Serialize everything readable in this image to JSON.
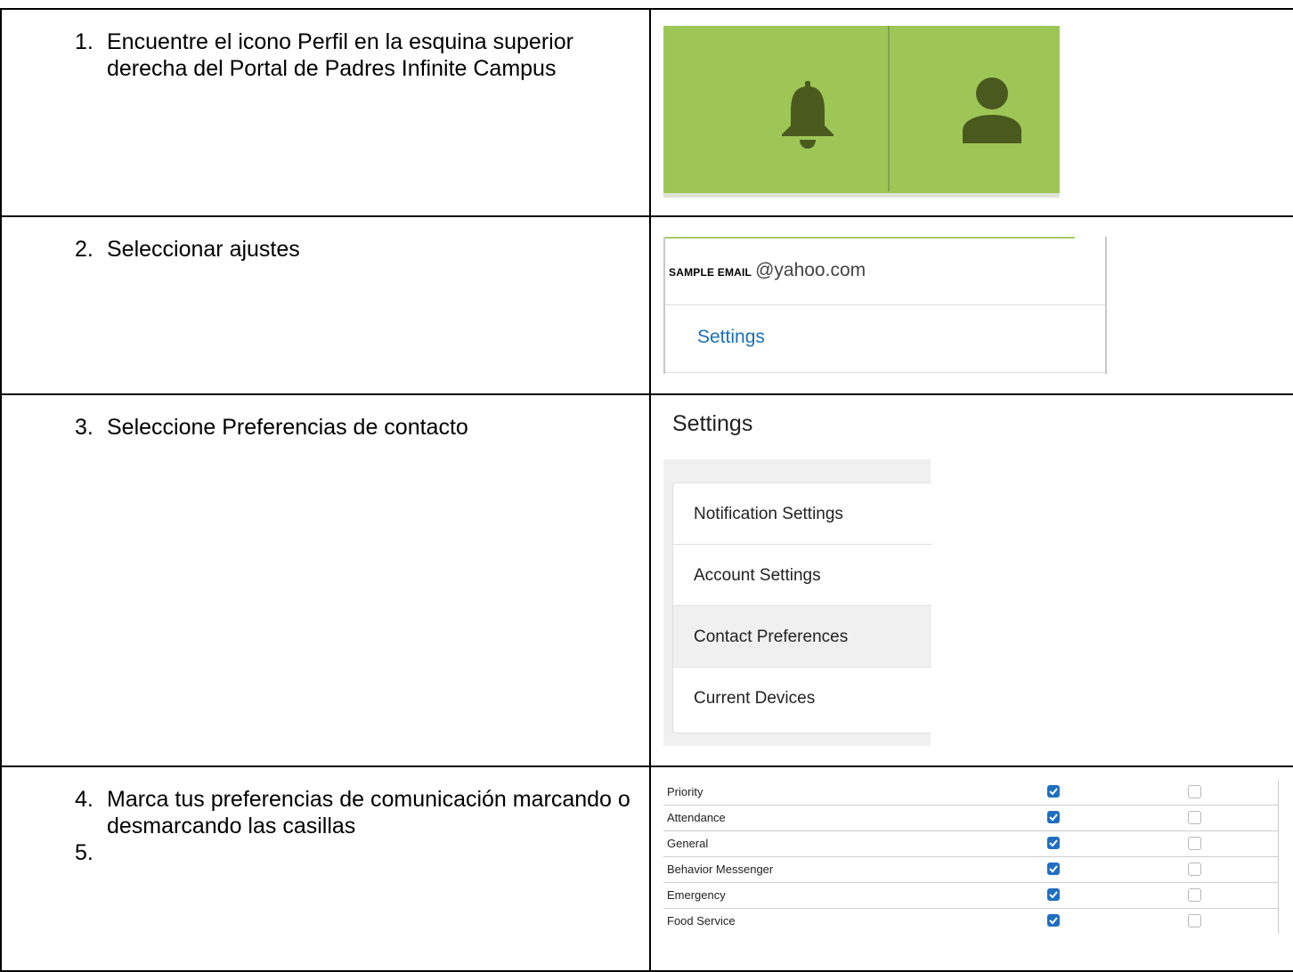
{
  "steps": [
    {
      "number": "1.",
      "text": "Encuentre el icono Perfil en la esquina superior derecha del Portal de Padres Infinite Campus"
    },
    {
      "number": "2.",
      "text": "Seleccionar ajustes"
    },
    {
      "number": "3.",
      "text": "Seleccione Preferencias de contacto"
    },
    {
      "number": "4.",
      "text": "Marca tus preferencias de comunicación marcando o desmarcando las casillas",
      "extra_number": "5."
    }
  ],
  "header_bar": {
    "color": "#9ec657",
    "icons": [
      "bell-icon",
      "person-icon"
    ]
  },
  "account_menu": {
    "email_label": "SAMPLE EMAIL",
    "email_domain": "@yahoo.com",
    "settings_link": "Settings"
  },
  "settings_page": {
    "title": "Settings",
    "items": [
      "Notification Settings",
      "Account Settings",
      "Contact Preferences",
      "Current Devices"
    ],
    "active_item": "Contact Preferences"
  },
  "contact_preferences": {
    "rows": [
      {
        "label": "Priority",
        "col1_checked": true,
        "col2_checked": false
      },
      {
        "label": "Attendance",
        "col1_checked": true,
        "col2_checked": false
      },
      {
        "label": "General",
        "col1_checked": true,
        "col2_checked": false
      },
      {
        "label": "Behavior Messenger",
        "col1_checked": true,
        "col2_checked": false
      },
      {
        "label": "Emergency",
        "col1_checked": true,
        "col2_checked": false
      },
      {
        "label": "Food Service",
        "col1_checked": true,
        "col2_checked": false
      }
    ]
  },
  "colors": {
    "accent_green": "#9ec657",
    "icon_dark": "#4a5a1f",
    "link_blue": "#1a6fb8",
    "checkbox_blue": "#1f6fc1"
  }
}
